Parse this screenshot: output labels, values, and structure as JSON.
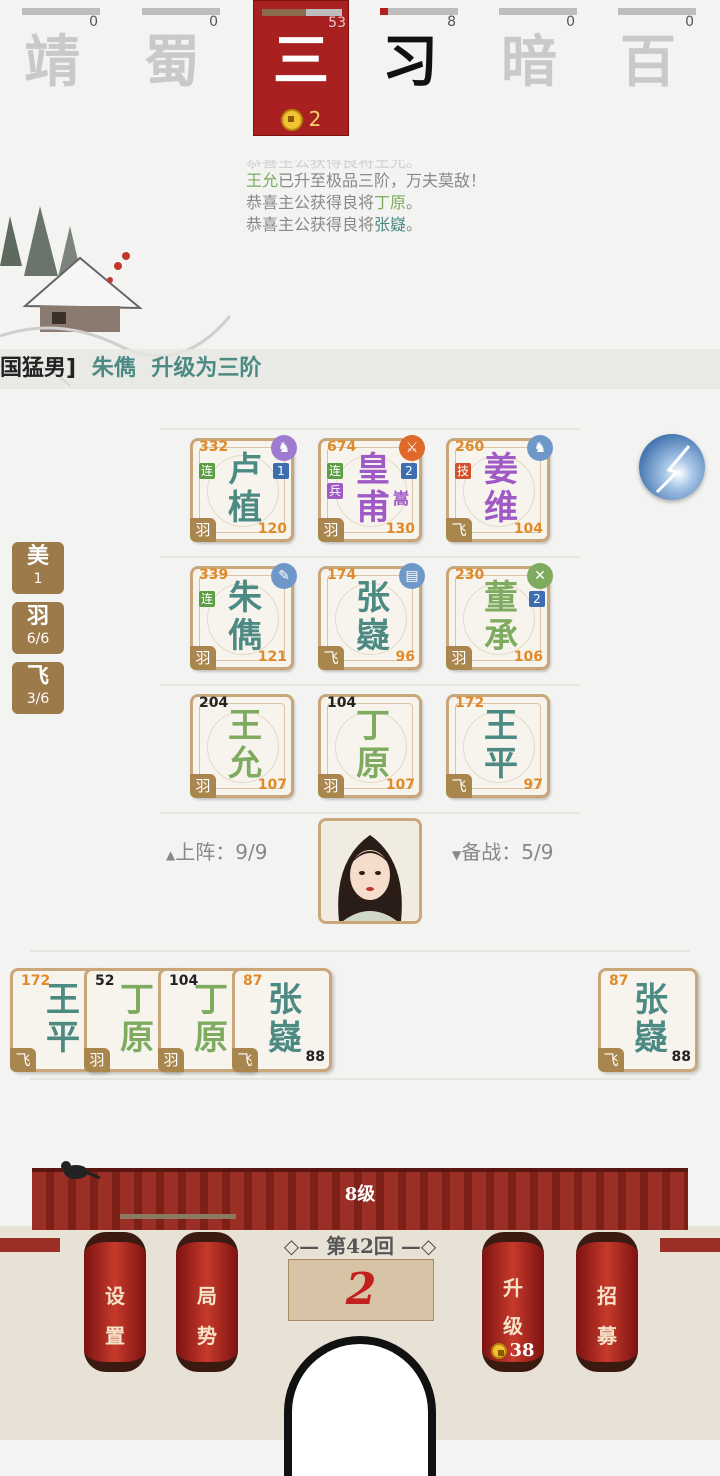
{
  "players": [
    {
      "glyph": "靖",
      "count": "0",
      "fill": 0
    },
    {
      "glyph": "蜀",
      "count": "0",
      "fill": 0
    },
    {
      "glyph": "三",
      "count": "53",
      "fill": 0.55,
      "coins": "2",
      "active": true
    },
    {
      "glyph": "习",
      "count": "8",
      "fill": 0.1,
      "dark": true
    },
    {
      "glyph": "暗",
      "count": "0",
      "fill": 0
    },
    {
      "glyph": "百",
      "count": "0",
      "fill": 0
    }
  ],
  "log": {
    "faint": "恭喜主公获得良将王允。",
    "l1_name": "王允",
    "l1_text": "已升至极品三阶，万夫莫敌！",
    "l2_text": "恭喜主公获得良将",
    "l2_name": "丁原",
    "l2_end": "。",
    "l3_text": "恭喜主公获得良将",
    "l3_name": "张嶷",
    "l3_end": "。"
  },
  "banner": {
    "prefix": "国猛男]",
    "name": "朱儁",
    "text": "升级为三阶"
  },
  "side_badges": [
    {
      "label": "美",
      "value": "1"
    },
    {
      "label": "羽",
      "value": "6/6"
    },
    {
      "label": "飞",
      "value": "3/6"
    }
  ],
  "board": [
    {
      "name1": "卢",
      "name2": "植",
      "hp": "332",
      "atk": "120",
      "cls": "羽",
      "color": "teal",
      "tag": "连",
      "lvl": "1"
    },
    {
      "name1": "皇",
      "name2": "甫",
      "hp": "674",
      "atk": "130",
      "cls": "羽",
      "color": "purple",
      "tag": "连",
      "tag2": "兵",
      "lvl": "2",
      "sub": "嵩"
    },
    {
      "name1": "姜",
      "name2": "维",
      "hp": "260",
      "atk": "104",
      "cls": "飞",
      "color": "purple",
      "tag": "技"
    },
    {
      "name1": "朱",
      "name2": "儁",
      "hp": "339",
      "atk": "121",
      "cls": "羽",
      "color": "teal",
      "tag": "连"
    },
    {
      "name1": "张",
      "name2": "嶷",
      "hp": "174",
      "atk": "96",
      "cls": "飞",
      "color": "teal"
    },
    {
      "name1": "董",
      "name2": "承",
      "hp": "230",
      "atk": "106",
      "cls": "羽",
      "color": "green",
      "lvl": "2"
    },
    {
      "name1": "王",
      "name2": "允",
      "hp": "204",
      "atk": "107",
      "cls": "羽",
      "color": "green",
      "hpBlack": true
    },
    {
      "name1": "丁",
      "name2": "原",
      "hp": "104",
      "atk": "107",
      "cls": "羽",
      "color": "green",
      "hpBlack": true
    },
    {
      "name1": "王",
      "name2": "平",
      "hp": "172",
      "atk": "97",
      "cls": "飞",
      "color": "teal"
    }
  ],
  "deploy": {
    "up": "上阵：9/9",
    "down": "备战：5/9"
  },
  "bench": [
    {
      "name1": "王",
      "name2": "平",
      "hp": "172",
      "cls": "飞",
      "color": "teal"
    },
    {
      "name1": "丁",
      "name2": "原",
      "hp": "52",
      "cls": "羽",
      "color": "green",
      "hpBlack": true
    },
    {
      "name1": "丁",
      "name2": "原",
      "hp": "104",
      "cls": "羽",
      "color": "green",
      "hpBlack": true
    },
    {
      "name1": "张",
      "name2": "嶷",
      "hp": "87",
      "atk": "88",
      "cls": "飞",
      "color": "teal"
    },
    {
      "name1": "张",
      "name2": "嶷",
      "hp": "87",
      "atk": "88",
      "cls": "飞",
      "color": "teal"
    }
  ],
  "footer": {
    "level": "8级",
    "round": "第42回",
    "timer": "2",
    "settings1": "设",
    "settings2": "置",
    "situation1": "局",
    "situation2": "势",
    "upgrade1": "升",
    "upgrade2": "级",
    "upgrade_cost": "38",
    "recruit1": "招",
    "recruit2": "募"
  }
}
